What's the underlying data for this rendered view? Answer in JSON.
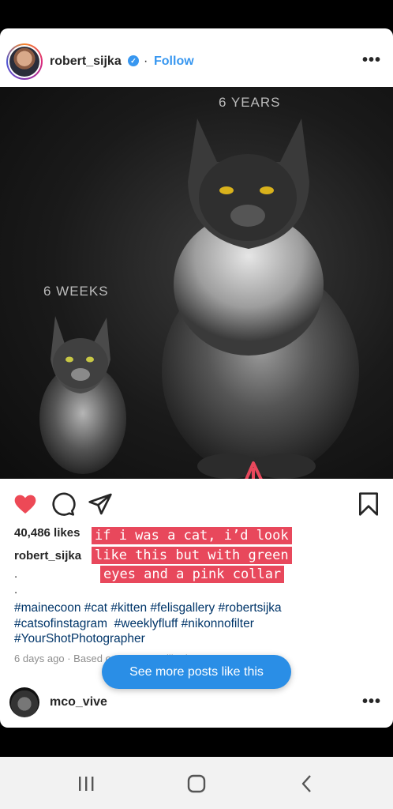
{
  "post": {
    "username": "robert_sijka",
    "verified_mark": "✓",
    "separator": "·",
    "follow_label": "Follow",
    "more_label": "•••",
    "photo_labels": {
      "top": "6 YEARS",
      "left": "6 WEEKS"
    },
    "likes": "40,486 likes",
    "caption_user": "robert_sijka",
    "caption_dots": [
      ".",
      "."
    ],
    "hashtags": [
      "#mainecoon",
      "#cat",
      "#kitten",
      "#felisgallery",
      "#robertsijka",
      "#catsofinstagram",
      "#weeklyfluff",
      "#nikonnofilter",
      "#YourShotPhotographer"
    ],
    "meta": "6 days ago · Based on posts you liked"
  },
  "overlay": {
    "lines": [
      "if i was a cat, i’d look",
      "like this but with green",
      "eyes and a pink collar"
    ],
    "color": "#e8485c"
  },
  "next_post": {
    "username": "mco_vive",
    "more_label": "•••"
  },
  "see_more_button": "See more posts like this",
  "icons": [
    "heart-icon",
    "comment-icon",
    "share-icon",
    "bookmark-icon",
    "recents-icon",
    "home-icon",
    "back-icon"
  ],
  "colors": {
    "accent": "#3897f0",
    "like_red": "#ed4956",
    "hashtag": "#003569"
  }
}
